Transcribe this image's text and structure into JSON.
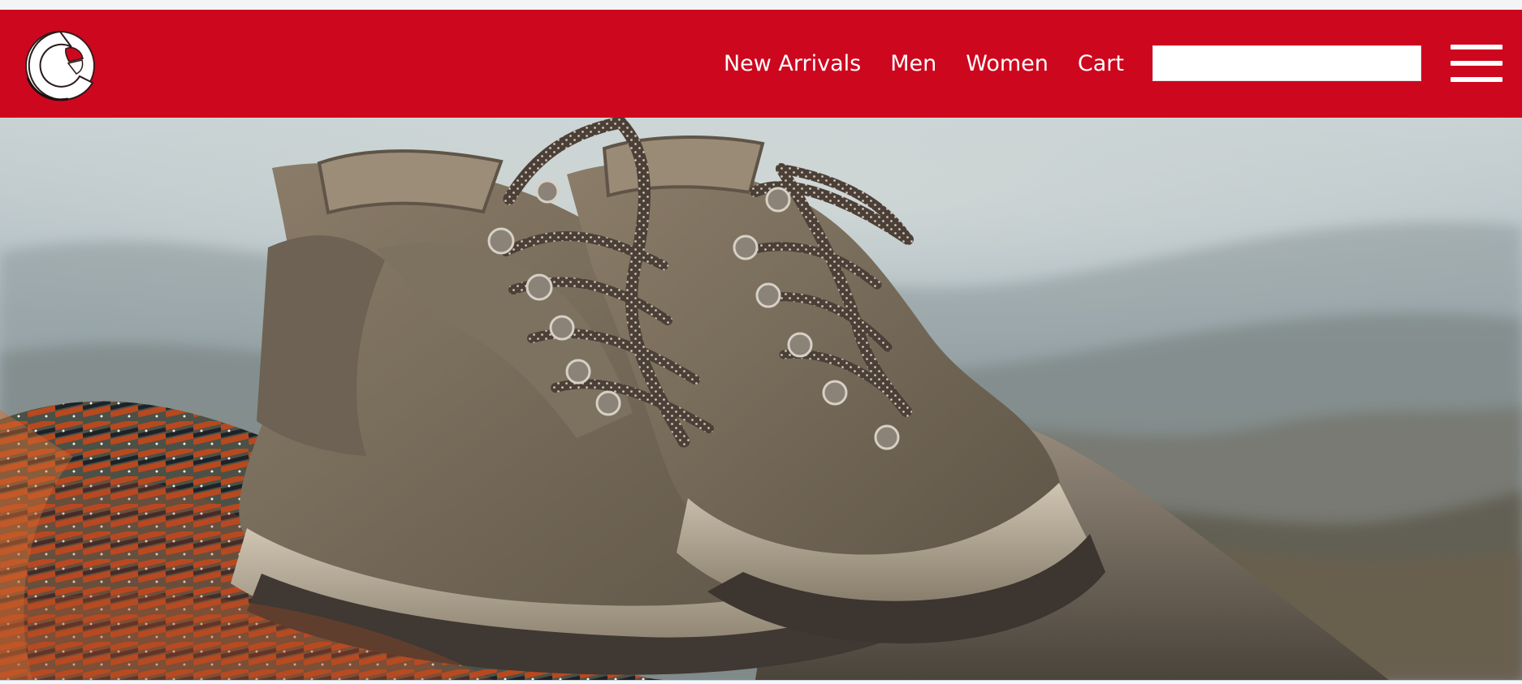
{
  "header": {
    "brand_color": "#cd071e",
    "logo_icon": "crescent-c-logo-icon",
    "nav": [
      {
        "label": "New Arrivals"
      },
      {
        "label": "Men"
      },
      {
        "label": "Women"
      },
      {
        "label": "Cart"
      }
    ],
    "search": {
      "value": "",
      "placeholder": ""
    },
    "menu_icon": "hamburger-menu-icon"
  },
  "hero": {
    "image_subject": "hiking boots on rock with blanket"
  }
}
